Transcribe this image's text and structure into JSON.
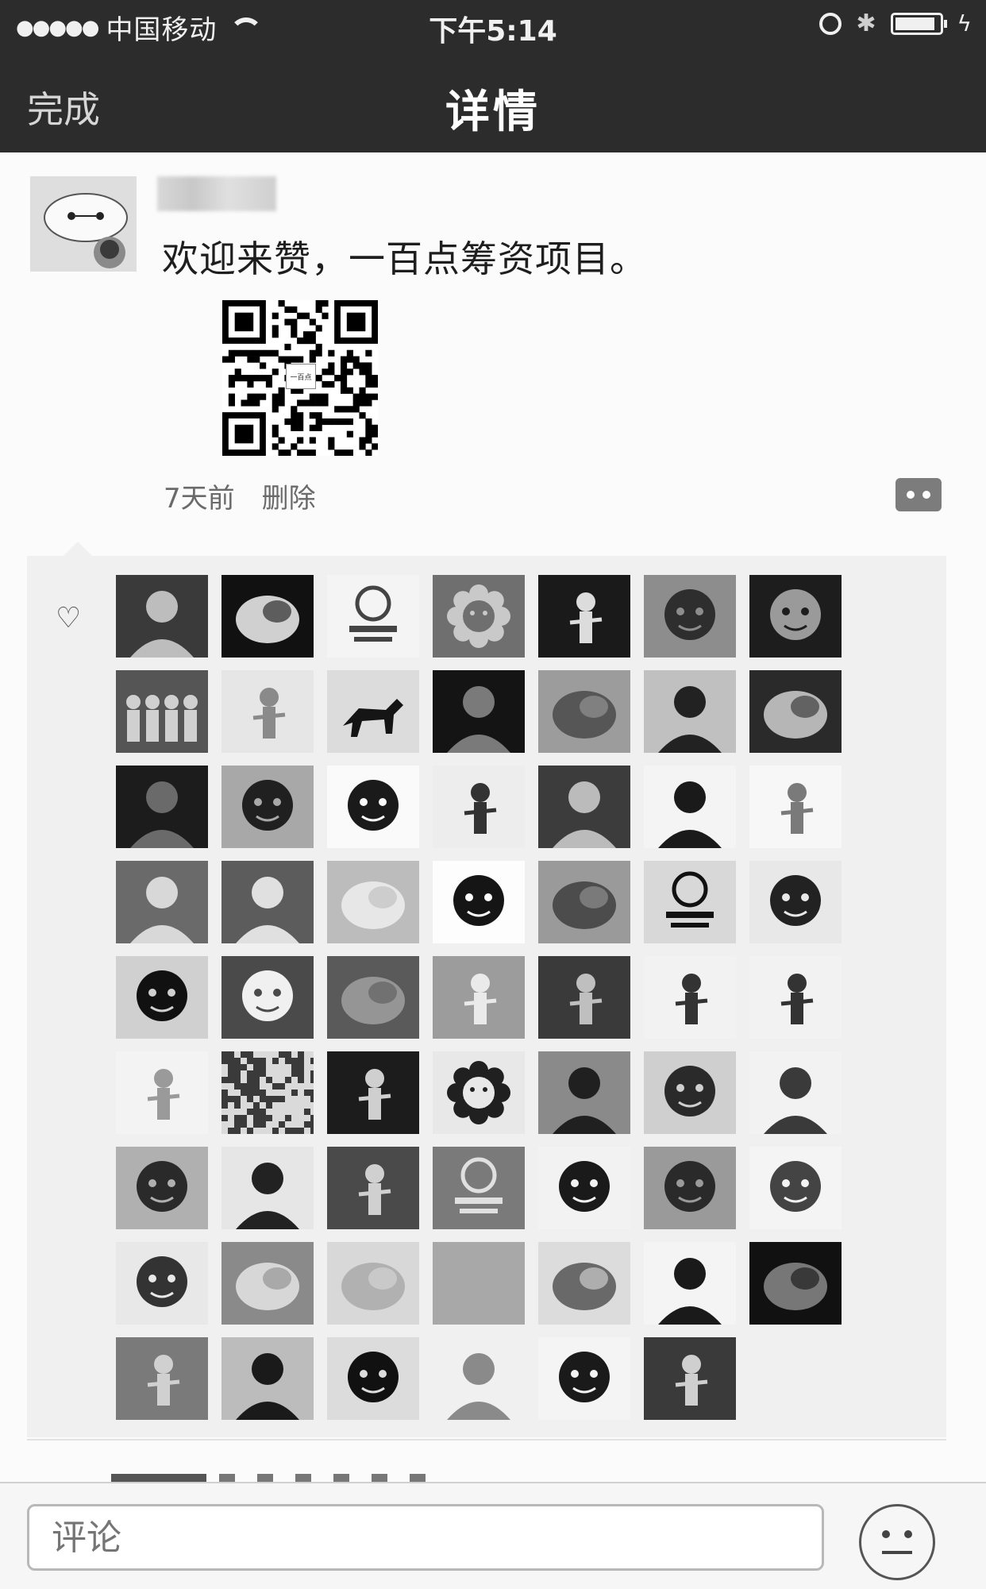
{
  "status_bar": {
    "signal": "●●●●●",
    "carrier": "中国移动",
    "time": "下午5:14",
    "bluetooth": "✱",
    "charging": "ϟ"
  },
  "nav": {
    "back_label": "完成",
    "title": "详情"
  },
  "post": {
    "text": "欢迎来赞，一百点筹资项目。",
    "qr_center": "一百点",
    "time_ago": "7天前",
    "delete_label": "删除"
  },
  "likes": {
    "heart": "♡",
    "avatars": [
      {
        "bg": "#3a3a3a",
        "fg": "#bdbdbd",
        "shape": "person"
      },
      {
        "bg": "#111111",
        "fg": "#f2f2f2",
        "shape": "blob"
      },
      {
        "bg": "#f4f4f4",
        "fg": "#444444",
        "shape": "logo"
      },
      {
        "bg": "#6f6f6f",
        "fg": "#c9c9c9",
        "shape": "flower"
      },
      {
        "bg": "#1a1a1a",
        "fg": "#dcdcdc",
        "shape": "figure"
      },
      {
        "bg": "#8d8d8d",
        "fg": "#2e2e2e",
        "shape": "cartoon"
      },
      {
        "bg": "#1d1d1d",
        "fg": "#9a9a9a",
        "shape": "cartoon"
      },
      {
        "bg": "#555555",
        "fg": "#d0d0d0",
        "shape": "group"
      },
      {
        "bg": "#e6e6e6",
        "fg": "#8a8a8a",
        "shape": "figure"
      },
      {
        "bg": "#dcdcdc",
        "fg": "#151515",
        "shape": "horse"
      },
      {
        "bg": "#141414",
        "fg": "#7a7a7a",
        "shape": "person"
      },
      {
        "bg": "#9c9c9c",
        "fg": "#4a4a4a",
        "shape": "blob"
      },
      {
        "bg": "#c0c0c0",
        "fg": "#222222",
        "shape": "person"
      },
      {
        "bg": "#2a2a2a",
        "fg": "#cfcfcf",
        "shape": "blob"
      },
      {
        "bg": "#1c1c1c",
        "fg": "#6a6a6a",
        "shape": "person"
      },
      {
        "bg": "#a8a8a8",
        "fg": "#202020",
        "shape": "cartoon"
      },
      {
        "bg": "#fafafa",
        "fg": "#1a1a1a",
        "shape": "cartoon"
      },
      {
        "bg": "#ededed",
        "fg": "#333333",
        "shape": "figure"
      },
      {
        "bg": "#3c3c3c",
        "fg": "#bbbbbb",
        "shape": "person"
      },
      {
        "bg": "#f4f4f4",
        "fg": "#1a1a1a",
        "shape": "person"
      },
      {
        "bg": "#f7f7f7",
        "fg": "#7a7a7a",
        "shape": "figure"
      },
      {
        "bg": "#6a6a6a",
        "fg": "#d8d8d8",
        "shape": "person"
      },
      {
        "bg": "#5c5c5c",
        "fg": "#e0e0e0",
        "shape": "person"
      },
      {
        "bg": "#bcbcbc",
        "fg": "#efefef",
        "shape": "blob"
      },
      {
        "bg": "#fdfdfd",
        "fg": "#151515",
        "shape": "cartoon"
      },
      {
        "bg": "#9a9a9a",
        "fg": "#3e3e3e",
        "shape": "blob"
      },
      {
        "bg": "#d8d8d8",
        "fg": "#111111",
        "shape": "logo"
      },
      {
        "bg": "#e8e8e8",
        "fg": "#222222",
        "shape": "cartoon"
      },
      {
        "bg": "#d0d0d0",
        "fg": "#111111",
        "shape": "cartoon"
      },
      {
        "bg": "#4a4a4a",
        "fg": "#f0f0f0",
        "shape": "cartoon"
      },
      {
        "bg": "#5a5a5a",
        "fg": "#a0a0a0",
        "shape": "blob"
      },
      {
        "bg": "#9c9c9c",
        "fg": "#eaeaea",
        "shape": "figure"
      },
      {
        "bg": "#3a3a3a",
        "fg": "#bfbfbf",
        "shape": "figure"
      },
      {
        "bg": "#f2f2f2",
        "fg": "#333333",
        "shape": "figure"
      },
      {
        "bg": "#f2f2f2",
        "fg": "#333333",
        "shape": "figure"
      },
      {
        "bg": "#f3f3f3",
        "fg": "#9a9a9a",
        "shape": "figure"
      },
      {
        "bg": "#3a3a3a",
        "fg": "#dadada",
        "shape": "noise"
      },
      {
        "bg": "#1c1c1c",
        "fg": "#cfcfcf",
        "shape": "figure"
      },
      {
        "bg": "#e8e8e8",
        "fg": "#202020",
        "shape": "flower"
      },
      {
        "bg": "#8a8a8a",
        "fg": "#202020",
        "shape": "person"
      },
      {
        "bg": "#cfcfcf",
        "fg": "#2a2a2a",
        "shape": "cartoon"
      },
      {
        "bg": "#f2f2f2",
        "fg": "#3a3a3a",
        "shape": "person"
      },
      {
        "bg": "#b0b0b0",
        "fg": "#2a2a2a",
        "shape": "cartoon"
      },
      {
        "bg": "#e6e6e6",
        "fg": "#222222",
        "shape": "person"
      },
      {
        "bg": "#4a4a4a",
        "fg": "#d0d0d0",
        "shape": "figure"
      },
      {
        "bg": "#7a7a7a",
        "fg": "#e0e0e0",
        "shape": "logo"
      },
      {
        "bg": "#f2f2f2",
        "fg": "#1a1a1a",
        "shape": "cartoon"
      },
      {
        "bg": "#9a9a9a",
        "fg": "#2a2a2a",
        "shape": "cartoon"
      },
      {
        "bg": "#f4f4f4",
        "fg": "#444444",
        "shape": "cartoon"
      },
      {
        "bg": "#e8e8e8",
        "fg": "#333333",
        "shape": "cartoon"
      },
      {
        "bg": "#8a8a8a",
        "fg": "#e4e4e4",
        "shape": "blob"
      },
      {
        "bg": "#d8d8d8",
        "fg": "#aaaaaa",
        "shape": "blob"
      },
      {
        "bg": "#a8a8a8",
        "fg": "#a8a8a8",
        "shape": "blank"
      },
      {
        "bg": "#dcdcdc",
        "fg": "#555555",
        "shape": "blob"
      },
      {
        "bg": "#f4f4f4",
        "fg": "#1a1a1a",
        "shape": "person"
      },
      {
        "bg": "#111111",
        "fg": "#8a8a8a",
        "shape": "blob"
      },
      {
        "bg": "#7a7a7a",
        "fg": "#d0d0d0",
        "shape": "figure"
      },
      {
        "bg": "#bcbcbc",
        "fg": "#1a1a1a",
        "shape": "person"
      },
      {
        "bg": "#dcdcdc",
        "fg": "#111111",
        "shape": "cartoon"
      },
      {
        "bg": "#f0f0f0",
        "fg": "#8a8a8a",
        "shape": "person"
      },
      {
        "bg": "#f4f4f4",
        "fg": "#1a1a1a",
        "shape": "cartoon"
      },
      {
        "bg": "#3a3a3a",
        "fg": "#cfcfcf",
        "shape": "figure"
      }
    ]
  },
  "next_post": {},
  "bottom_bar": {
    "comment_placeholder": "评论"
  }
}
